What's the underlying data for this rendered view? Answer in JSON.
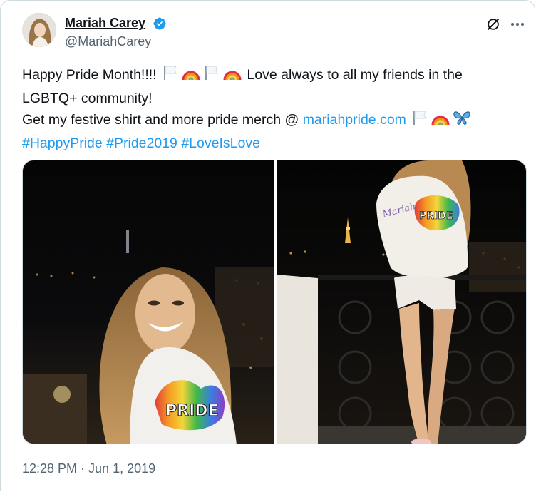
{
  "author": {
    "name": "Mariah Carey",
    "handle": "@MariahCarey",
    "verified": true,
    "verified_color": "#1d9bf0"
  },
  "tweet": {
    "line1_pre": "Happy Pride Month!!!! ",
    "line1_post": " Love always to all my friends in the",
    "line2": "LGBTQ+ community!",
    "line3_pre": "Get my festive shirt and more pride merch @ ",
    "line3_link": "mariahpride.com",
    "hashtags": [
      "#HappyPride",
      "#Pride2019",
      "#LoveIsLove"
    ],
    "link_color": "#1d9bf0"
  },
  "icons": {
    "header_right": [
      "grok-icon",
      "more-icon"
    ],
    "emoji": [
      "white-flag",
      "rainbow",
      "butterfly"
    ]
  },
  "media": {
    "photos": [
      {
        "description_name": "photo-left"
      },
      {
        "description_name": "photo-right"
      }
    ]
  },
  "timestamp": "12:28 PM · Jun 1, 2019"
}
